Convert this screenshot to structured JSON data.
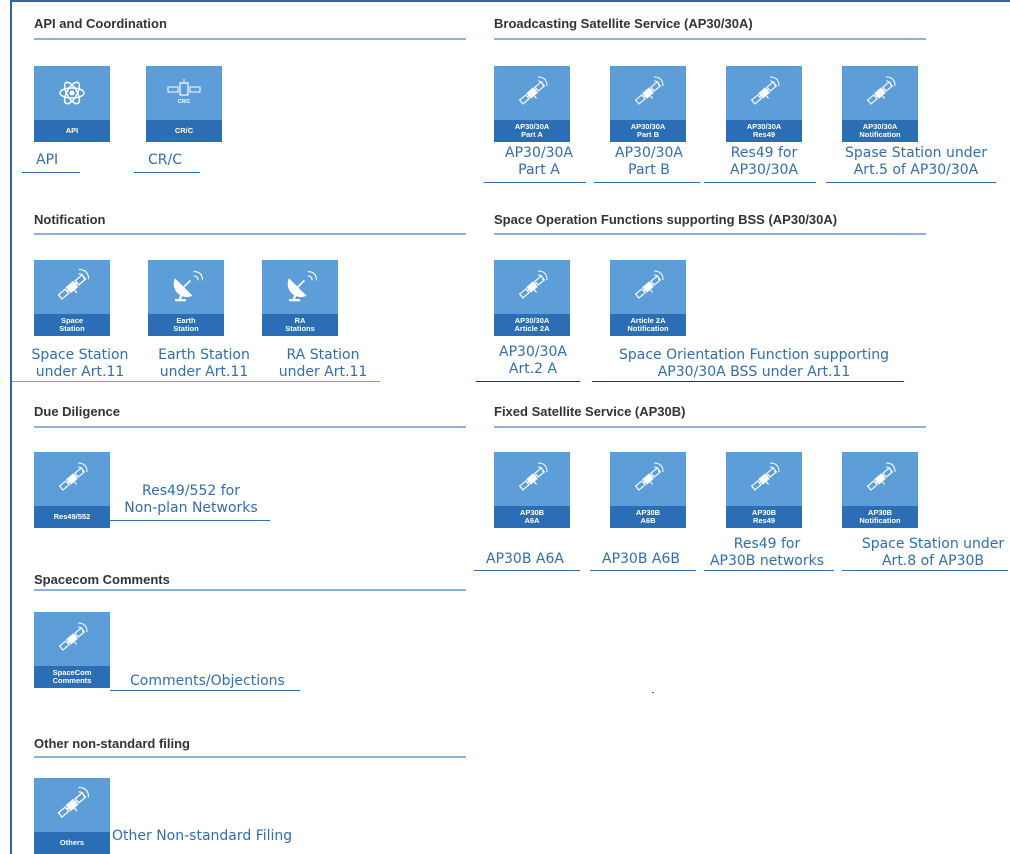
{
  "sections": {
    "api": "API and Coordination",
    "bss": "Broadcasting Satellite Service (AP30/30A)",
    "notification": "Notification",
    "sof": "Space Operation Functions supporting BSS (AP30/30A)",
    "due": "Due Diligence",
    "fss": "Fixed Satellite Service (AP30B)",
    "spacecom": "Spacecom Comments",
    "other": "Other non-standard filing"
  },
  "tiles": {
    "api": {
      "band": "API",
      "label": "API"
    },
    "crc": {
      "band": "CR/C",
      "icon_text": "CR/C",
      "label": "CR/C"
    },
    "bss_a": {
      "band1": "AP30/30A",
      "band2": "Part A",
      "label1": "AP30/30A",
      "label2": "Part A"
    },
    "bss_b": {
      "band1": "AP30/30A",
      "band2": "Part B",
      "label1": "AP30/30A",
      "label2": "Part B"
    },
    "bss_res49": {
      "band1": "AP30/30A",
      "band2": "Res49",
      "label1": "Res49 for",
      "label2": "AP30/30A"
    },
    "bss_notif": {
      "band1": "AP30/30A",
      "band2": "Notification",
      "label1": "Spase Station under",
      "label2": "Art.5 of AP30/30A"
    },
    "space_station": {
      "band1": "Space",
      "band2": "Station",
      "label1": "Space Station",
      "label2": "under Art.11"
    },
    "earth_station": {
      "band1": "Earth",
      "band2": "Station",
      "label1": "Earth Station",
      "label2": "under Art.11"
    },
    "ra_station": {
      "band1": "RA",
      "band2": "Stations",
      "label1": "RA Station",
      "label2": "under Art.11"
    },
    "sof_2a": {
      "band1": "AP30/30A",
      "band2": "Article 2A",
      "label1": "AP30/30A",
      "label2": "Art.2 A"
    },
    "sof_notif": {
      "band1": "Article 2A",
      "band2": "Notification",
      "label1": "Space Orientation Function supporting",
      "label2": "AP30/30A BSS under Art.11"
    },
    "res49_552": {
      "band": "Res49/552",
      "label1": "Res49/552 for",
      "label2": "Non-plan Networks"
    },
    "fss_a6a": {
      "band1": "AP30B",
      "band2": "A6A",
      "label": "AP30B A6A"
    },
    "fss_a6b": {
      "band1": "AP30B",
      "band2": "A6B",
      "label": "AP30B A6B"
    },
    "fss_res49": {
      "band1": "AP30B",
      "band2": "Res49",
      "label1": "Res49 for",
      "label2": "AP30B networks"
    },
    "fss_notif": {
      "band1": "AP30B",
      "band2": "Notification",
      "label1": "Space Station under",
      "label2": "Art.8 of AP30B"
    },
    "spacecom": {
      "band1": "SpaceCom",
      "band2": "Comments",
      "label": "Comments/Objections"
    },
    "others": {
      "band": "Others",
      "label": "Other Non-standard Filing"
    }
  },
  "colors": {
    "tile_top": "#5d9dd8",
    "tile_band": "#2b6eb5",
    "label_text": "#2f6fb0",
    "notification_underline": "#e8892f",
    "sof_underline": "#2a2a9a",
    "section_rule": "#8fb1d9"
  },
  "icons": {
    "api": "orbit-icon",
    "crc": "satellite-front-icon",
    "satellite": "satellite-icon",
    "earth_station": "dish-antenna-icon"
  }
}
